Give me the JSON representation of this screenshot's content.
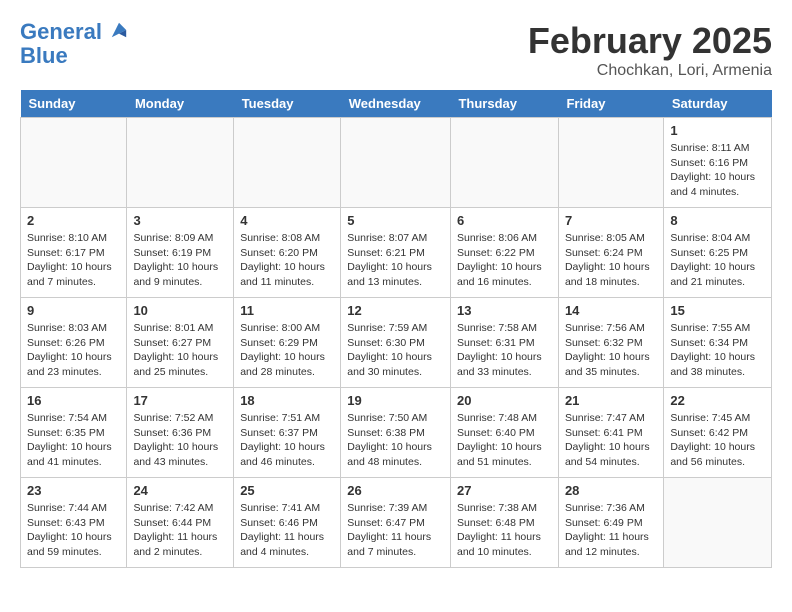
{
  "header": {
    "logo_line1": "General",
    "logo_line2": "Blue",
    "title": "February 2025",
    "subtitle": "Chochkan, Lori, Armenia"
  },
  "days_of_week": [
    "Sunday",
    "Monday",
    "Tuesday",
    "Wednesday",
    "Thursday",
    "Friday",
    "Saturday"
  ],
  "weeks": [
    [
      {
        "day": "",
        "info": ""
      },
      {
        "day": "",
        "info": ""
      },
      {
        "day": "",
        "info": ""
      },
      {
        "day": "",
        "info": ""
      },
      {
        "day": "",
        "info": ""
      },
      {
        "day": "",
        "info": ""
      },
      {
        "day": "1",
        "info": "Sunrise: 8:11 AM\nSunset: 6:16 PM\nDaylight: 10 hours and 4 minutes."
      }
    ],
    [
      {
        "day": "2",
        "info": "Sunrise: 8:10 AM\nSunset: 6:17 PM\nDaylight: 10 hours and 7 minutes."
      },
      {
        "day": "3",
        "info": "Sunrise: 8:09 AM\nSunset: 6:19 PM\nDaylight: 10 hours and 9 minutes."
      },
      {
        "day": "4",
        "info": "Sunrise: 8:08 AM\nSunset: 6:20 PM\nDaylight: 10 hours and 11 minutes."
      },
      {
        "day": "5",
        "info": "Sunrise: 8:07 AM\nSunset: 6:21 PM\nDaylight: 10 hours and 13 minutes."
      },
      {
        "day": "6",
        "info": "Sunrise: 8:06 AM\nSunset: 6:22 PM\nDaylight: 10 hours and 16 minutes."
      },
      {
        "day": "7",
        "info": "Sunrise: 8:05 AM\nSunset: 6:24 PM\nDaylight: 10 hours and 18 minutes."
      },
      {
        "day": "8",
        "info": "Sunrise: 8:04 AM\nSunset: 6:25 PM\nDaylight: 10 hours and 21 minutes."
      }
    ],
    [
      {
        "day": "9",
        "info": "Sunrise: 8:03 AM\nSunset: 6:26 PM\nDaylight: 10 hours and 23 minutes."
      },
      {
        "day": "10",
        "info": "Sunrise: 8:01 AM\nSunset: 6:27 PM\nDaylight: 10 hours and 25 minutes."
      },
      {
        "day": "11",
        "info": "Sunrise: 8:00 AM\nSunset: 6:29 PM\nDaylight: 10 hours and 28 minutes."
      },
      {
        "day": "12",
        "info": "Sunrise: 7:59 AM\nSunset: 6:30 PM\nDaylight: 10 hours and 30 minutes."
      },
      {
        "day": "13",
        "info": "Sunrise: 7:58 AM\nSunset: 6:31 PM\nDaylight: 10 hours and 33 minutes."
      },
      {
        "day": "14",
        "info": "Sunrise: 7:56 AM\nSunset: 6:32 PM\nDaylight: 10 hours and 35 minutes."
      },
      {
        "day": "15",
        "info": "Sunrise: 7:55 AM\nSunset: 6:34 PM\nDaylight: 10 hours and 38 minutes."
      }
    ],
    [
      {
        "day": "16",
        "info": "Sunrise: 7:54 AM\nSunset: 6:35 PM\nDaylight: 10 hours and 41 minutes."
      },
      {
        "day": "17",
        "info": "Sunrise: 7:52 AM\nSunset: 6:36 PM\nDaylight: 10 hours and 43 minutes."
      },
      {
        "day": "18",
        "info": "Sunrise: 7:51 AM\nSunset: 6:37 PM\nDaylight: 10 hours and 46 minutes."
      },
      {
        "day": "19",
        "info": "Sunrise: 7:50 AM\nSunset: 6:38 PM\nDaylight: 10 hours and 48 minutes."
      },
      {
        "day": "20",
        "info": "Sunrise: 7:48 AM\nSunset: 6:40 PM\nDaylight: 10 hours and 51 minutes."
      },
      {
        "day": "21",
        "info": "Sunrise: 7:47 AM\nSunset: 6:41 PM\nDaylight: 10 hours and 54 minutes."
      },
      {
        "day": "22",
        "info": "Sunrise: 7:45 AM\nSunset: 6:42 PM\nDaylight: 10 hours and 56 minutes."
      }
    ],
    [
      {
        "day": "23",
        "info": "Sunrise: 7:44 AM\nSunset: 6:43 PM\nDaylight: 10 hours and 59 minutes."
      },
      {
        "day": "24",
        "info": "Sunrise: 7:42 AM\nSunset: 6:44 PM\nDaylight: 11 hours and 2 minutes."
      },
      {
        "day": "25",
        "info": "Sunrise: 7:41 AM\nSunset: 6:46 PM\nDaylight: 11 hours and 4 minutes."
      },
      {
        "day": "26",
        "info": "Sunrise: 7:39 AM\nSunset: 6:47 PM\nDaylight: 11 hours and 7 minutes."
      },
      {
        "day": "27",
        "info": "Sunrise: 7:38 AM\nSunset: 6:48 PM\nDaylight: 11 hours and 10 minutes."
      },
      {
        "day": "28",
        "info": "Sunrise: 7:36 AM\nSunset: 6:49 PM\nDaylight: 11 hours and 12 minutes."
      },
      {
        "day": "",
        "info": ""
      }
    ]
  ]
}
